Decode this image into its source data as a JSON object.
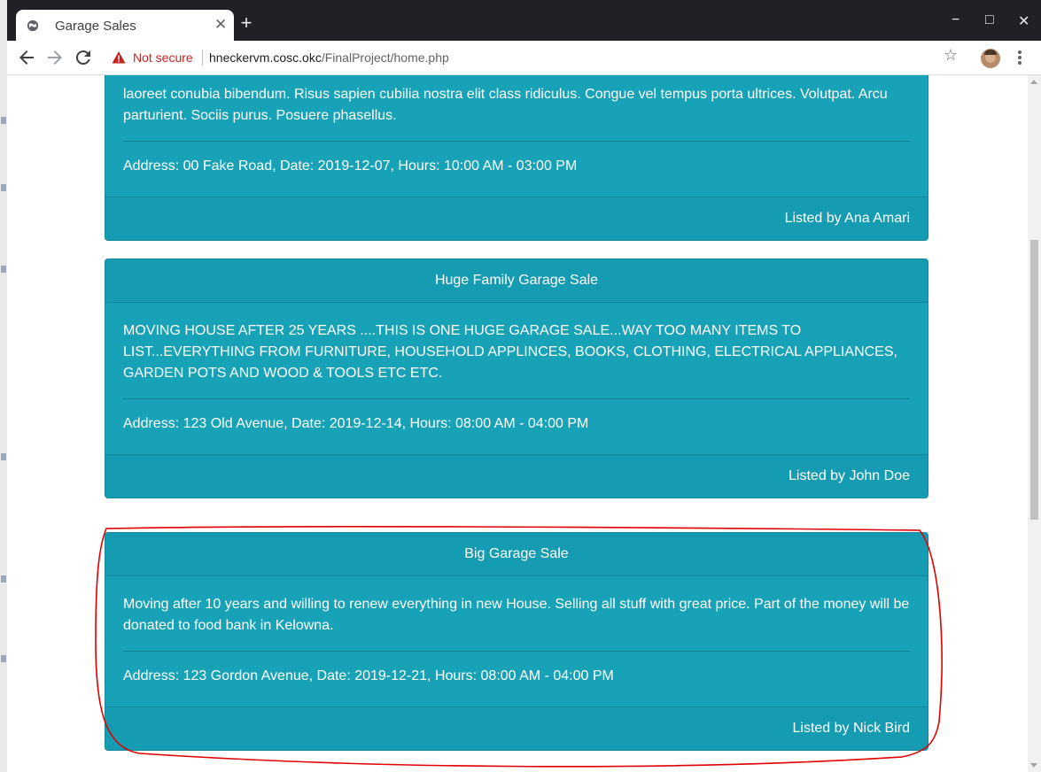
{
  "browser": {
    "tab_title": "Garage Sales",
    "tab_close": "✕",
    "new_tab": "+",
    "window_controls": {
      "minimize": "−",
      "maximize": "□",
      "close": "✕"
    },
    "security_label": "Not secure",
    "url_host": "hneckervm.cosc.okc",
    "url_path": "/FinalProject/home.php",
    "star": "☆"
  },
  "listings": [
    {
      "title": "",
      "description": "laoreet conubia bibendum. Risus sapien cubilia nostra elit class ridiculus. Congue vel tempus porta ultrices. Volutpat. Arcu parturient. Sociis purus. Posuere phasellus.",
      "details": "Address: 00 Fake Road, Date: 2019-12-07, Hours: 10:00 AM - 03:00 PM",
      "listed_by": "Listed by Ana Amari"
    },
    {
      "title": "Huge Family Garage Sale",
      "description": "MOVING HOUSE AFTER 25 YEARS ....THIS IS ONE HUGE GARAGE SALE...WAY TOO MANY ITEMS TO LIST...EVERYTHING FROM FURNITURE, HOUSEHOLD APPLINCES, BOOKS, CLOTHING, ELECTRICAL APPLIANCES, GARDEN POTS AND WOOD & TOOLS ETC ETC.",
      "details": "Address: 123 Old Avenue, Date: 2019-12-14, Hours: 08:00 AM - 04:00 PM",
      "listed_by": "Listed by John Doe"
    },
    {
      "title": "Big Garage Sale",
      "description": "Moving after 10 years and willing to renew everything in new House. Selling all stuff with great price. Part of the money will be donated to food bank in Kelowna.",
      "details": "Address: 123 Gordon Avenue, Date: 2019-12-21, Hours: 08:00 AM - 04:00 PM",
      "listed_by": "Listed by Nick Bird"
    }
  ],
  "colors": {
    "card_bg": "#17a2b8",
    "card_text": "#ffffff",
    "annotation": "#e00000",
    "not_secure": "#c5221f",
    "titlebar": "#202124"
  }
}
